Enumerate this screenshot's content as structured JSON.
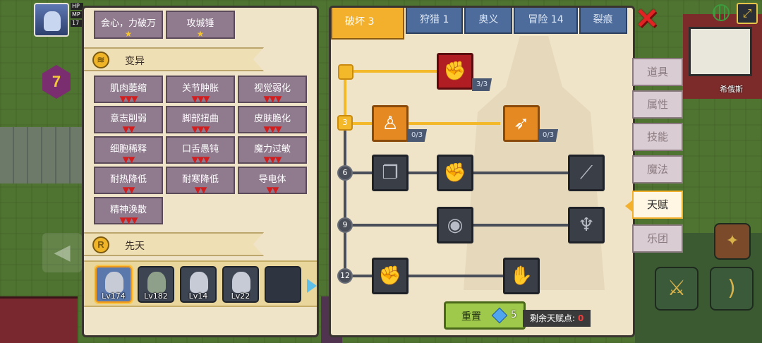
{
  "hud": {
    "stats": [
      "HP",
      "MP",
      "17"
    ],
    "level": "7",
    "place_label": "希俄斯"
  },
  "left_panel": {
    "top_chips": [
      {
        "label": "会心，力破万",
        "mark": "★"
      },
      {
        "label": "攻城锤",
        "mark": "★"
      }
    ],
    "mutation_section": {
      "title": "变异",
      "icon": "dna-icon"
    },
    "mutations": [
      {
        "label": "肌肉萎缩",
        "mark": "▼▼▼"
      },
      {
        "label": "关节肿胀",
        "mark": "▼▼▼"
      },
      {
        "label": "视觉弱化",
        "mark": "▼▼▼"
      },
      {
        "label": "意志削弱",
        "mark": "▼▼"
      },
      {
        "label": "脚部扭曲",
        "mark": "▼▼▼"
      },
      {
        "label": "皮肤脆化",
        "mark": "▼▼▼"
      },
      {
        "label": "细胞稀释",
        "mark": "▼▼"
      },
      {
        "label": "口舌愚钝",
        "mark": "▼▼▼"
      },
      {
        "label": "魔力过敏",
        "mark": "▼▼▼"
      },
      {
        "label": "耐热降低",
        "mark": "▼▼"
      },
      {
        "label": "耐寒降低",
        "mark": "▼▼"
      },
      {
        "label": "导电体",
        "mark": "▼▼"
      },
      {
        "label": "精神涣散",
        "mark": "▼▼▼"
      }
    ],
    "innate_section": {
      "title": "先天",
      "badge": "R"
    },
    "heroes": [
      {
        "level": "Lv174",
        "selected": true
      },
      {
        "level": "Lv182",
        "selected": false
      },
      {
        "level": "Lv14",
        "selected": false
      },
      {
        "level": "Lv22",
        "selected": false
      },
      {
        "level": "",
        "selected": false
      }
    ]
  },
  "right_panel": {
    "tabs": [
      {
        "label": "破坏 3",
        "active": true
      },
      {
        "label": "狩猎 1",
        "active": false
      },
      {
        "label": "奥义",
        "active": false
      },
      {
        "label": "冒险 14",
        "active": false
      },
      {
        "label": "裂痕",
        "active": false
      }
    ],
    "tree_levels": [
      "3",
      "6",
      "9",
      "12"
    ],
    "talents": {
      "arm_wrestle": {
        "icon": "arm-wrestle-icon",
        "count": "3/3"
      },
      "body": {
        "icon": "muscle-body-icon",
        "count": "0/3"
      },
      "arrow": {
        "icon": "arrow-hit-icon",
        "count": "0/3"
      }
    },
    "reset": {
      "label": "重置",
      "cost": "5"
    },
    "remaining": {
      "label": "剩余天赋点:",
      "value": "0"
    }
  },
  "side_menu": [
    {
      "label": "道具",
      "active": false
    },
    {
      "label": "属性",
      "active": false
    },
    {
      "label": "技能",
      "active": false
    },
    {
      "label": "魔法",
      "active": false
    },
    {
      "label": "天赋",
      "active": true
    },
    {
      "label": "乐团",
      "active": false
    }
  ],
  "close_icon": "✕"
}
